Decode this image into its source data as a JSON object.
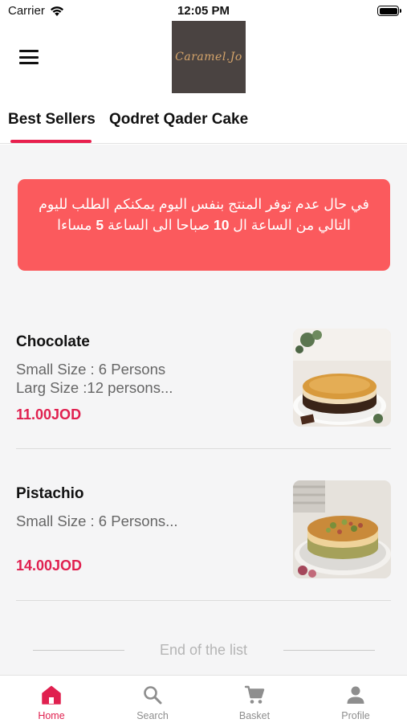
{
  "status_bar": {
    "carrier": "Carrier",
    "time": "12:05 PM"
  },
  "header": {
    "logo_text": "Caramel.Jo",
    "menu_icon": "hamburger-menu-icon"
  },
  "tabs": [
    {
      "label": "Best Sellers",
      "active": true
    },
    {
      "label": "Qodret Qader Cake",
      "active": false
    }
  ],
  "notice": {
    "text_before": "في حال عدم توفر المنتج بنفس اليوم يمكنكم الطلب لليوم التالي من الساعة ال ",
    "hour_start": "10",
    "text_middle": " صباحا الى الساعة ",
    "hour_end": "5",
    "text_after": " مساءا",
    "background": "#fb5a5d"
  },
  "products": [
    {
      "name": "Chocolate",
      "desc_line1": "Small Size : 6 Persons",
      "desc_line2": "Larg Size :12 persons...",
      "price": "11.00JOD"
    },
    {
      "name": "Pistachio",
      "desc_line1": "Small Size : 6 Persons...",
      "price": "14.00JOD"
    }
  ],
  "end_of_list": "End of the list",
  "bottom_nav": [
    {
      "label": "Home",
      "icon": "home-icon",
      "active": true
    },
    {
      "label": "Search",
      "icon": "search-icon",
      "active": false
    },
    {
      "label": "Basket",
      "icon": "cart-icon",
      "active": false
    },
    {
      "label": "Profile",
      "icon": "person-icon",
      "active": false
    }
  ],
  "colors": {
    "accent": "#e0204f",
    "notice": "#fb5a5d",
    "text_muted": "#666666"
  }
}
